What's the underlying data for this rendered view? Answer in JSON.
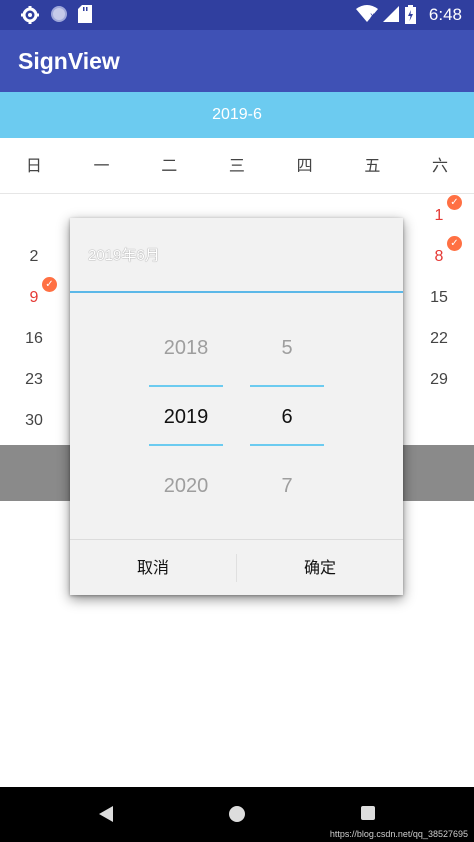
{
  "status_bar": {
    "time": "6:48",
    "icons_left": [
      "gear-icon",
      "circle-icon",
      "sd-card-icon"
    ],
    "icons_right": [
      "wifi-icon",
      "signal-icon",
      "battery-icon"
    ]
  },
  "app_bar": {
    "title": "SignView"
  },
  "calendar": {
    "month_label": "2019-6",
    "weekdays": [
      "日",
      "一",
      "二",
      "三",
      "四",
      "五",
      "六"
    ],
    "visible_days": [
      {
        "label": "1",
        "signed": true
      },
      {
        "label": "2",
        "signed": false
      },
      {
        "label": "8",
        "signed": true
      },
      {
        "label": "9",
        "signed": true
      },
      {
        "label": "15",
        "signed": false
      },
      {
        "label": "16",
        "signed": false
      },
      {
        "label": "22",
        "signed": false
      },
      {
        "label": "23",
        "signed": false
      },
      {
        "label": "29",
        "signed": false
      },
      {
        "label": "30",
        "signed": false
      }
    ],
    "signed_color": "#e53935",
    "check_color": "#ff7043"
  },
  "dialog": {
    "title": "2019年6月",
    "year_picker": {
      "prev": "2018",
      "selected": "2019",
      "next": "2020"
    },
    "month_picker": {
      "prev": "5",
      "selected": "6",
      "next": "7"
    },
    "cancel_label": "取消",
    "confirm_label": "确定"
  },
  "nav_bar": {
    "icons": [
      "back-icon",
      "home-icon",
      "recents-icon"
    ]
  },
  "watermark": "https://blog.csdn.net/qq_38527695",
  "colors": {
    "status_bar": "#303f9f",
    "app_bar": "#3f51b5",
    "month_bar": "#6ccbf0",
    "accent_line": "#5bb8e8"
  }
}
